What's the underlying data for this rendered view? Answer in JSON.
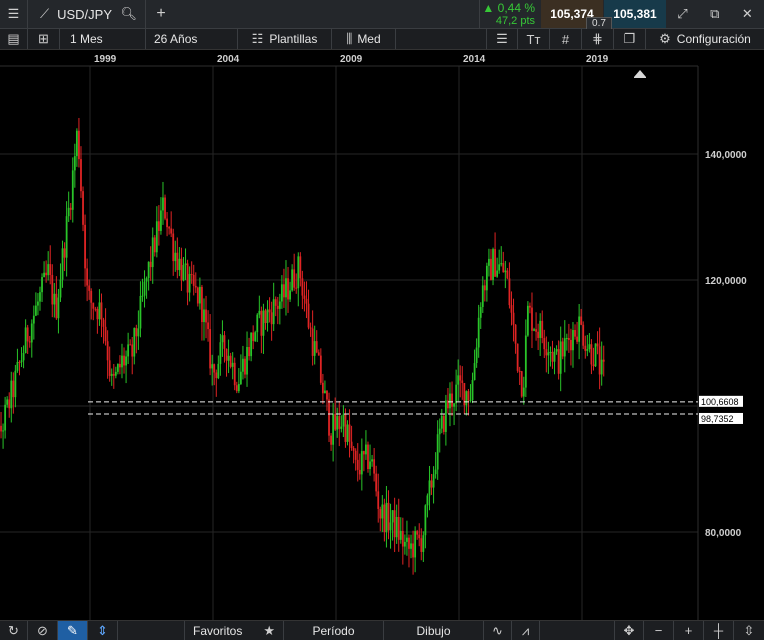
{
  "header": {
    "menu_icon": "hamburger-icon",
    "chart_type_icon": "line-chart-icon",
    "symbol": "USD/JPY",
    "search_icon": "search-icon",
    "add_icon": "plus-icon",
    "change_pct": "0,44 %",
    "change_pts": "47,2 pts",
    "bid": "105,374",
    "ask": "105,381",
    "spread": "0.7",
    "expand_icon": "expand-icon",
    "popout_icon": "popout-icon",
    "close_icon": "close-icon",
    "colors": {
      "up": "#37c837",
      "bid_bg": "#3b2f22",
      "ask_bg": "#173a4a"
    }
  },
  "toolbar": {
    "list_icon": "list-icon",
    "layout_icon": "grid-layout-icon",
    "interval": "1 Mes",
    "range": "26 Años",
    "templates_icon": "templates-icon",
    "templates": "Plantillas",
    "price_type_icon": "candles-icon",
    "price_type": "Med",
    "indicators_icon": "indicators-icon",
    "text_icon": "text-size-icon",
    "grid_icon": "hash-icon",
    "drawing_icon": "crossed-tools-icon",
    "copy_icon": "copy-icon",
    "settings_icon": "gear-icon",
    "settings": "Configuración"
  },
  "bottombar": {
    "refresh_icon": "refresh-icon",
    "cancel_icon": "cancel-icon",
    "pencil_icon": "pencil-icon",
    "arrows_icon": "updown-arrows-icon",
    "favorites": "Favoritos",
    "star_icon": "star-icon",
    "period": "Período",
    "drawing": "Dibujo",
    "wave_icon": "wave-icon",
    "pattern_icon": "pattern-icon",
    "move_icon": "move-icon",
    "minus_icon": "minus-icon",
    "plus_icon": "plus-icon",
    "crosshair_icon": "crosshair-icon",
    "fit_icon": "fit-vertical-icon"
  },
  "chart_data": {
    "type": "candlestick",
    "x_ticks": [
      "1999",
      "2004",
      "2009",
      "2014",
      "2019"
    ],
    "x_tick_years": [
      1999,
      2004,
      2009,
      2014,
      2019
    ],
    "xlim": [
      1994.8,
      2019.9
    ],
    "y_ticks": [
      "140,0000",
      "120,0000",
      "80,0000"
    ],
    "y_tick_values": [
      140,
      120,
      80
    ],
    "ylim": [
      67,
      152
    ],
    "grid": true,
    "horizontal_lines": [
      {
        "label": "100,6608",
        "value": 100.6608
      },
      {
        "label": "98,7352",
        "value": 98.7352
      }
    ],
    "anchors": [
      [
        1994.8,
        83
      ],
      [
        1995.3,
        95
      ],
      [
        1995.9,
        103
      ],
      [
        1996.5,
        112
      ],
      [
        1997.3,
        121
      ],
      [
        1997.6,
        115
      ],
      [
        1998.2,
        133
      ],
      [
        1998.5,
        144
      ],
      [
        1998.9,
        117
      ],
      [
        1999.5,
        115
      ],
      [
        1999.9,
        103
      ],
      [
        2000.3,
        107
      ],
      [
        2000.7,
        108
      ],
      [
        2001.4,
        122
      ],
      [
        2002.0,
        132
      ],
      [
        2002.4,
        125
      ],
      [
        2003.0,
        119
      ],
      [
        2003.5,
        117
      ],
      [
        2004.0,
        105
      ],
      [
        2004.5,
        110
      ],
      [
        2005.0,
        104
      ],
      [
        2005.7,
        112
      ],
      [
        2006.3,
        115
      ],
      [
        2006.8,
        117
      ],
      [
        2007.5,
        122
      ],
      [
        2007.9,
        113
      ],
      [
        2008.4,
        104
      ],
      [
        2008.8,
        96
      ],
      [
        2009.3,
        98
      ],
      [
        2009.8,
        90
      ],
      [
        2010.4,
        92
      ],
      [
        2010.8,
        83
      ],
      [
        2011.4,
        81
      ],
      [
        2011.9,
        77
      ],
      [
        2012.5,
        79
      ],
      [
        2013.1,
        93
      ],
      [
        2013.5,
        100
      ],
      [
        2014.0,
        103
      ],
      [
        2014.5,
        102
      ],
      [
        2014.9,
        118
      ],
      [
        2015.4,
        123
      ],
      [
        2015.9,
        121
      ],
      [
        2016.4,
        107
      ],
      [
        2016.6,
        103
      ],
      [
        2016.8,
        115
      ],
      [
        2017.1,
        113
      ],
      [
        2017.6,
        110
      ],
      [
        2018.0,
        107
      ],
      [
        2018.5,
        111
      ],
      [
        2018.9,
        113
      ],
      [
        2019.3,
        109
      ],
      [
        2019.6,
        108
      ],
      [
        2019.8,
        105
      ],
      [
        2019.9,
        105
      ]
    ]
  }
}
